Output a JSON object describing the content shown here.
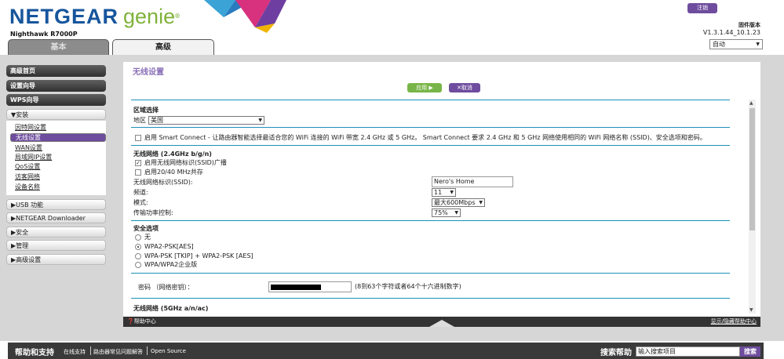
{
  "header": {
    "brand": "NETGEAR",
    "brand_suffix": "genie",
    "trademark": "®",
    "model": "Nighthawk R7000P",
    "logout": "注销",
    "firmware_label": "固件版本",
    "firmware_version": "V1.3.1.44_10.1.23",
    "language": "自动",
    "tabs": [
      {
        "label": "基本"
      },
      {
        "label": "高级"
      }
    ]
  },
  "sidebar": {
    "top_buttons": [
      "高级首页",
      "设置向导",
      "WPS向导"
    ],
    "setup_group": "▼安装",
    "setup_items": [
      "因特网设置",
      "无线设置",
      "WAN设置",
      "局域网IP设置",
      "QoS设置",
      "访客网络",
      "设备名称"
    ],
    "groups": [
      "▶USB 功能",
      "▶NETGEAR Downloader",
      "▶安全",
      "▶管理",
      "▶高级设置"
    ]
  },
  "main": {
    "title": "无线设置",
    "apply": "应用 ▶",
    "cancel": "✕取消",
    "region_section": "区域选择",
    "region_label": "地区",
    "region_value": "美国",
    "smart_connect": "启用 Smart Connect - 让路由器智能选择最适合您的 WiFi 连接的 WiFi 带宽 2.4 GHz 或 5 GHz。 Smart Connect 要求 2.4 GHz 和 5 GHz 网络使用相同的 WiFi 网络名称 (SSID)、安全选项和密码。",
    "net24_title": "无线网络 (2.4GHz b/g/n)",
    "ssid_broadcast": "启用无线网络标识(SSID)广播",
    "coexist": "启用20/40 MHz共存",
    "ssid_label": "无线网络标识(SSID):",
    "ssid_value": "Nero's Home",
    "channel_label": "频道:",
    "channel_value": "11",
    "mode_label": "模式:",
    "mode_value": "最大600Mbps",
    "power_label": "传输功率控制:",
    "power_value": "75%",
    "security_title": "安全选项",
    "security_options": [
      "无",
      "WPA2-PSK[AES]",
      "WPA-PSK [TKIP] + WPA2-PSK [AES]",
      "WPA/WPA2企业版"
    ],
    "security_selected": 1,
    "password_label": "密码 （网络密钥）：",
    "password_hint": "(8到63个字符或者64个十六进制数字)",
    "net5_title": "无线网络 (5GHz a/n/ac)"
  },
  "helpbar": {
    "help_center": "帮助中心",
    "show_hide": "显示/隐藏帮助中心"
  },
  "footer": {
    "title": "帮助和支持",
    "links": [
      "在线支持",
      "路由器常见问题解答",
      "Open Source"
    ],
    "search_label": "搜索帮助",
    "search_placeholder": "输入搜索项目",
    "search_button": "搜索"
  },
  "colors": {
    "brand_blue": "#16559c",
    "genie_green": "#7fb23a",
    "accent_purple": "#6e4c9e",
    "apply_green": "#78b548",
    "divider_blue": "#1e8fb7"
  }
}
